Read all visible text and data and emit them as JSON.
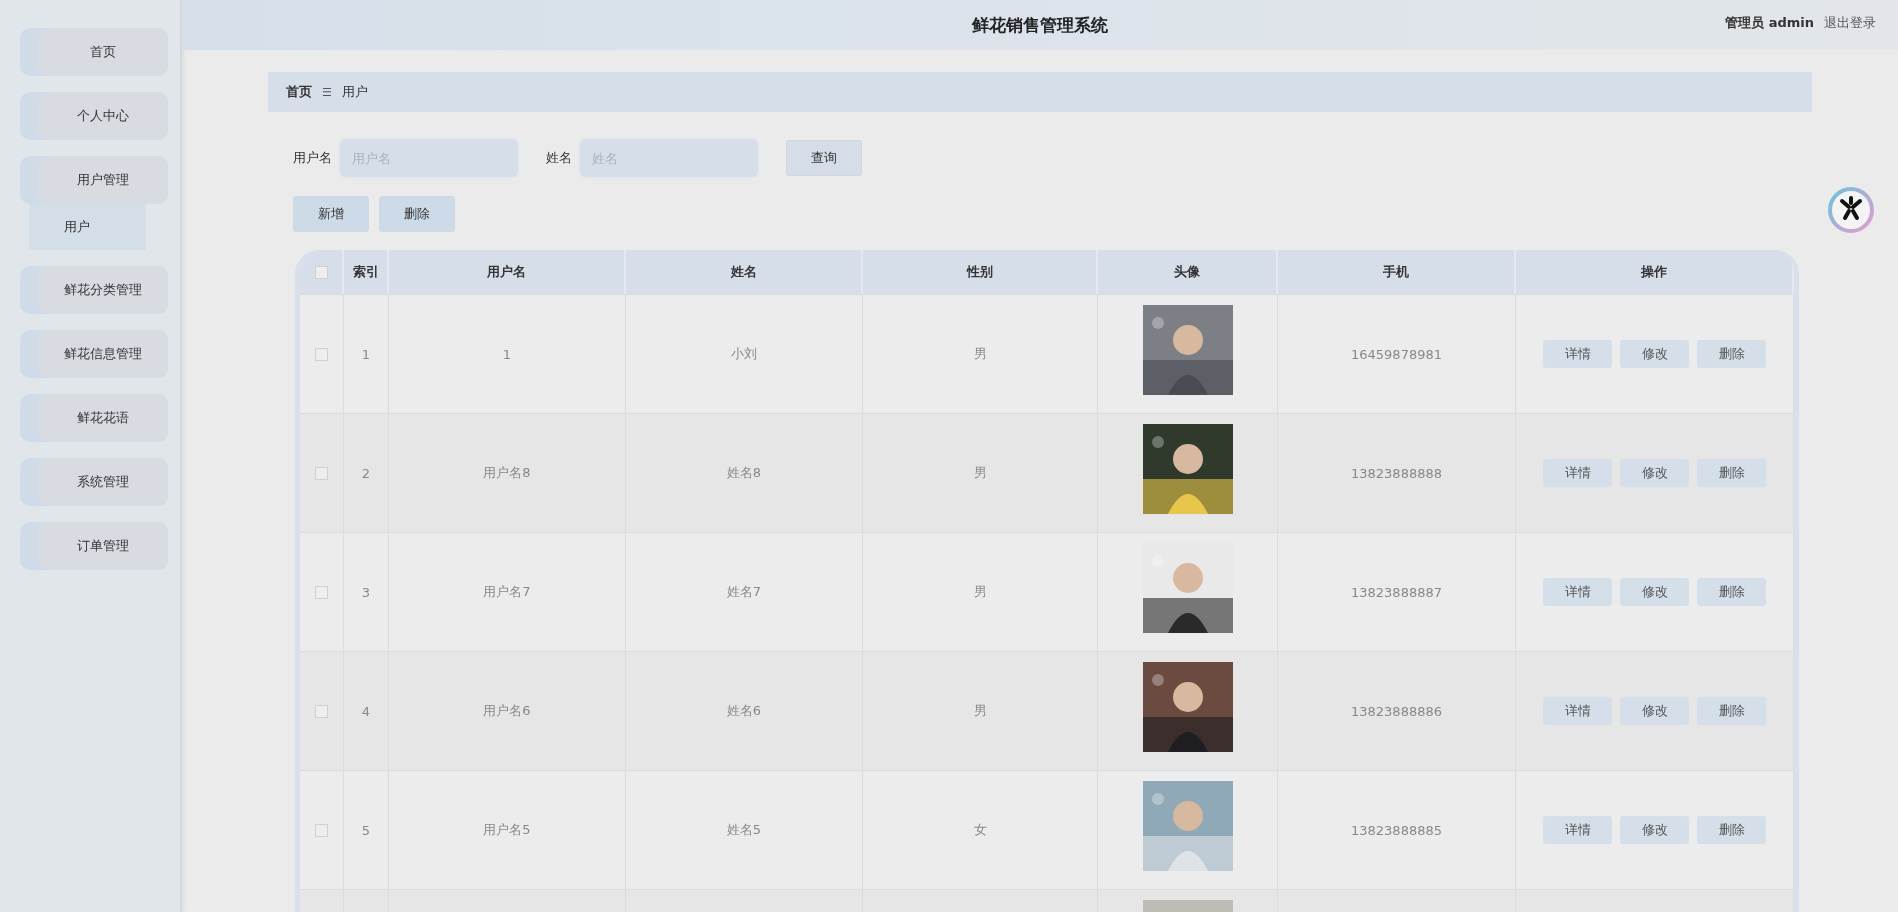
{
  "header": {
    "title": "鲜花销售管理系统",
    "user": "管理员 admin",
    "logout": "退出登录"
  },
  "sidebar": {
    "items": [
      {
        "label": "首页",
        "selected": false
      },
      {
        "label": "个人中心",
        "selected": false
      },
      {
        "label": "用户管理",
        "selected": false,
        "children": [
          {
            "label": "用户",
            "selected": true
          }
        ]
      },
      {
        "label": "鲜花分类管理",
        "selected": false
      },
      {
        "label": "鲜花信息管理",
        "selected": false
      },
      {
        "label": "鲜花花语",
        "selected": false
      },
      {
        "label": "系统管理",
        "selected": false
      },
      {
        "label": "订单管理",
        "selected": false
      }
    ]
  },
  "breadcrumb": {
    "home": "首页",
    "separator": "☰",
    "current": "用户"
  },
  "search": {
    "fields": [
      {
        "label": "用户名",
        "placeholder": "用户名"
      },
      {
        "label": "姓名",
        "placeholder": "姓名"
      }
    ],
    "button": "查询"
  },
  "actions": [
    "新增",
    "删除"
  ],
  "table": {
    "header_checked": false,
    "columns": [
      "索引",
      "用户名",
      "姓名",
      "性别",
      "头像",
      "手机",
      "操作"
    ],
    "rows": [
      {
        "checked": false,
        "index": "1",
        "username": "1",
        "name": "小刘",
        "gender": "男",
        "avatar": {
          "kind": "picture"
        },
        "phone": "16459878981",
        "buttons": [
          "详情",
          "修改",
          "删除"
        ]
      },
      {
        "checked": false,
        "index": "2",
        "username": "用户名8",
        "name": "姓名8",
        "gender": "男",
        "avatar": {
          "kind": "picture"
        },
        "phone": "13823888888",
        "buttons": [
          "详情",
          "修改",
          "删除"
        ]
      },
      {
        "checked": false,
        "index": "3",
        "username": "用户名7",
        "name": "姓名7",
        "gender": "男",
        "avatar": {
          "kind": "picture"
        },
        "phone": "13823888887",
        "buttons": [
          "详情",
          "修改",
          "删除"
        ]
      },
      {
        "checked": false,
        "index": "4",
        "username": "用户名6",
        "name": "姓名6",
        "gender": "男",
        "avatar": {
          "kind": "picture"
        },
        "phone": "13823888886",
        "buttons": [
          "详情",
          "修改",
          "删除"
        ]
      },
      {
        "checked": false,
        "index": "5",
        "username": "用户名5",
        "name": "姓名5",
        "gender": "女",
        "avatar": {
          "kind": "picture"
        },
        "phone": "13823888885",
        "buttons": [
          "详情",
          "修改",
          "删除"
        ]
      },
      {
        "avatar": {
          "kind": "picture"
        }
      }
    ]
  }
}
